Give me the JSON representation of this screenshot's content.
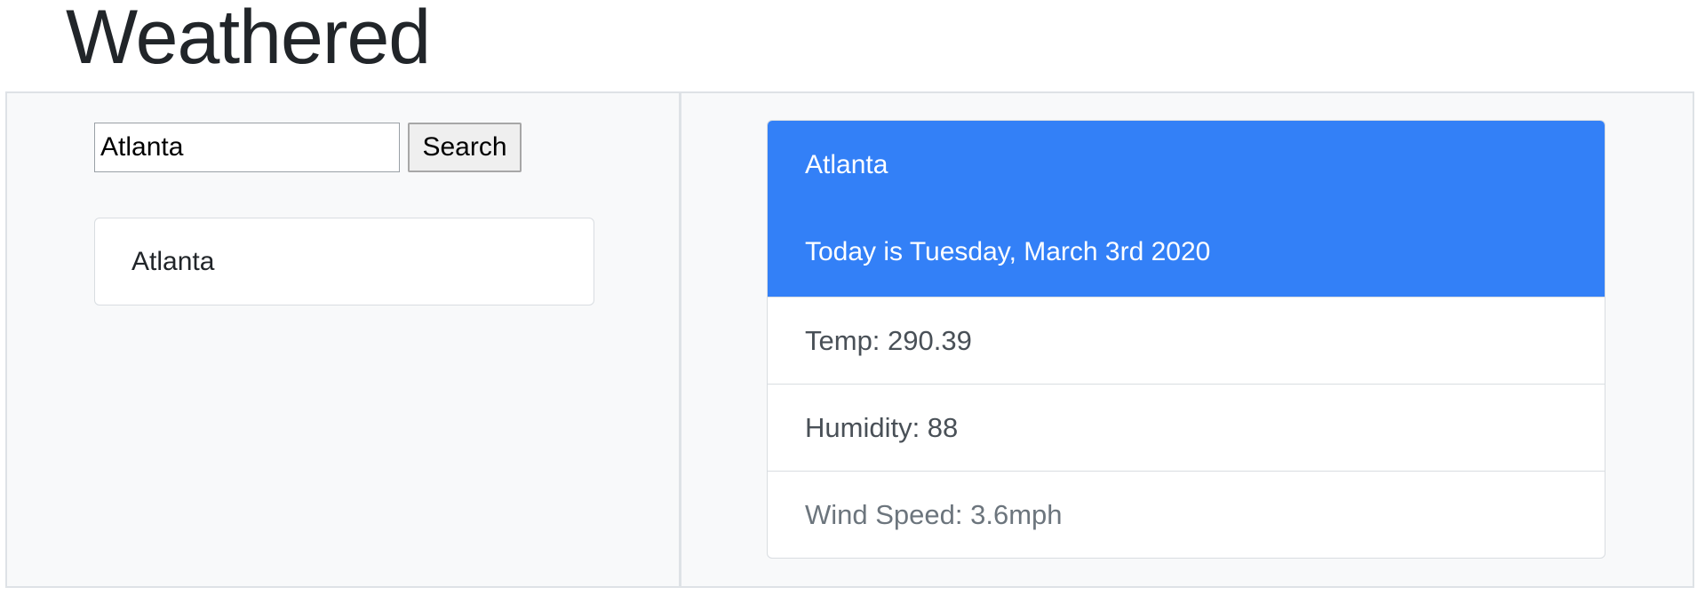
{
  "app": {
    "title": "Weathered"
  },
  "search": {
    "value": "Atlanta",
    "button_label": "Search"
  },
  "history": {
    "items": [
      {
        "label": "Atlanta"
      }
    ]
  },
  "weather": {
    "city": "Atlanta",
    "date_text": "Today is Tuesday, March 3rd 2020",
    "temp_text": "Temp: 290.39",
    "humidity_text": "Humidity: 88",
    "wind_text": "Wind Speed: 3.6mph"
  },
  "colors": {
    "header_background": "#3380f7",
    "panel_background": "#f8f9fa",
    "border": "#dee2e6"
  }
}
